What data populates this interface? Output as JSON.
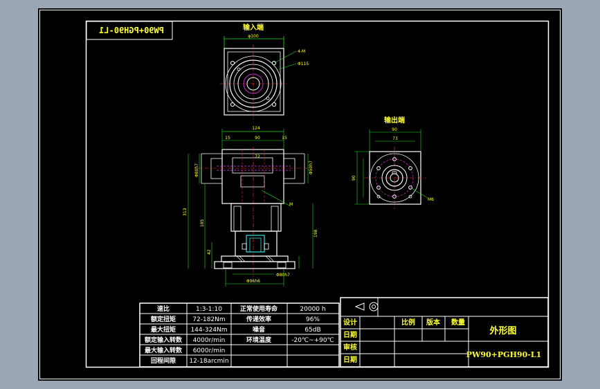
{
  "drawing": {
    "mirrored_title": "PW90+PGH90-L1",
    "input_end_label": "输入端",
    "output_end_label": "输出端",
    "drawing_name": "外形图",
    "drawing_number": "PW90+PGH90-L1"
  },
  "dims": {
    "input_top": "φ100",
    "input_r1": "4-M",
    "input_r2": "Φ115",
    "side_124": "124",
    "side_15a": "15",
    "side_90": "90",
    "side_15b": "15",
    "side_72": "72",
    "side_left_a": "Φ80h7",
    "side_right_a": "Φ50h7",
    "side_313": "313",
    "side_185": "185",
    "side_42": "42",
    "side_right_198": "198",
    "bottom_1": "Φ96h6",
    "bottom_2": "Φ80h7",
    "out_90": "90",
    "out_73": "73",
    "out_left": "90",
    "out_right": "M6"
  },
  "spec_table": {
    "rows": [
      [
        "速比",
        "1:3-1:10",
        "正常使用寿命",
        "20000 h"
      ],
      [
        "额定扭矩",
        "72-182Nm",
        "传递效率",
        "96%"
      ],
      [
        "最大扭矩",
        "144-324Nm",
        "噪音",
        "65dB"
      ],
      [
        "额定输入转数",
        "4000r/min",
        "环境温度",
        "-20℃~+90℃"
      ],
      [
        "最大输入转数",
        "6000r/min",
        "",
        ""
      ],
      [
        "回程间隙",
        "12-18arcmin",
        "",
        ""
      ]
    ]
  },
  "title_block": {
    "design": "设计",
    "date1": "日期",
    "review": "审核",
    "date2": "日期",
    "scale": "比例",
    "version": "版本",
    "quantity": "数量"
  },
  "colors": {
    "background": "#9aa6b4",
    "sheet": "#000000",
    "outline": "#ffffff",
    "text": "#ffff33",
    "dim_green": "#22e022",
    "center_red": "#ff3333",
    "hidden_magenta": "#ff33ff",
    "part_cyan": "#33dddd"
  }
}
